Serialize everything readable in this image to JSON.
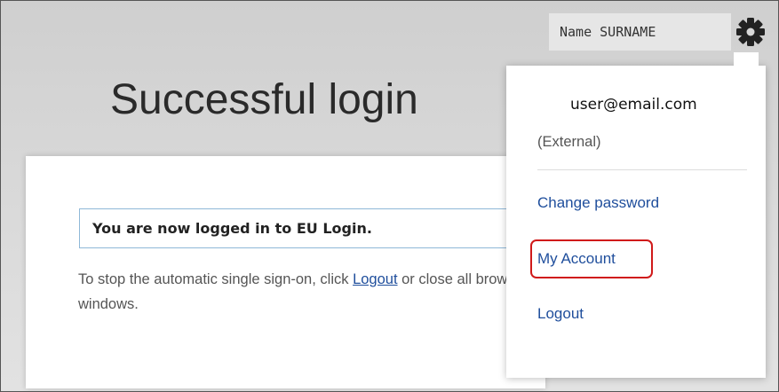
{
  "page": {
    "title": "Successful login"
  },
  "card": {
    "notice": "You are now logged in to EU Login.",
    "info_before": "To stop the automatic single sign-on, click ",
    "logout_link": "Logout",
    "info_after": " or close all browser windows."
  },
  "header": {
    "user_name": "Name SURNAME",
    "settings_icon": "gear-icon"
  },
  "user_menu": {
    "email": "user@email.com",
    "account_type": "(External)",
    "items": [
      {
        "label": "Change password"
      },
      {
        "label": "My Account",
        "highlighted": true
      },
      {
        "label": "Logout"
      }
    ]
  },
  "colors": {
    "link": "#1f4e9c",
    "highlight_border": "#d01a1a",
    "notice_border": "#8fb8d8"
  }
}
